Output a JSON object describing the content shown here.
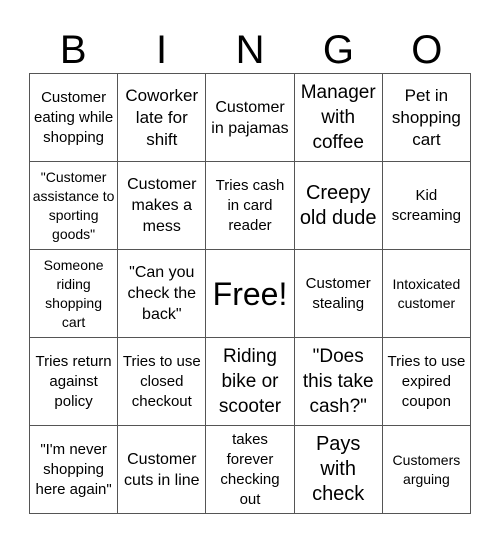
{
  "header": [
    "B",
    "I",
    "N",
    "G",
    "O"
  ],
  "cells": [
    [
      "Customer eating while shopping",
      "Coworker late for shift",
      "Customer in pajamas",
      "Manager with coffee",
      "Pet in shopping cart"
    ],
    [
      "\"Customer assistance to sporting goods\"",
      "Customer makes a mess",
      "Tries cash in card reader",
      "Creepy old dude",
      "Kid screaming"
    ],
    [
      "Someone riding shopping cart",
      "\"Can you check the back\"",
      "Free!",
      "Customer stealing",
      "Intoxicated customer"
    ],
    [
      "Tries return against policy",
      "Tries to use closed checkout",
      "Riding bike or scooter",
      "\"Does this take cash?\"",
      "Tries to use expired coupon"
    ],
    [
      "\"I'm never shopping here again\"",
      "Customer cuts in line",
      "takes forever checking out",
      "Pays with check",
      "Customers arguing"
    ]
  ]
}
